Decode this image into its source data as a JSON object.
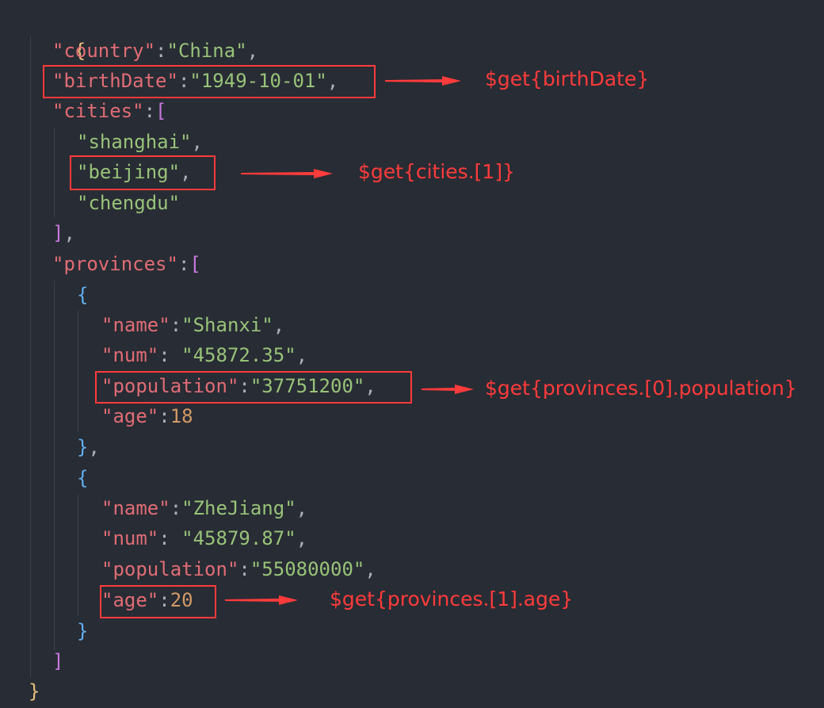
{
  "json": {
    "open_brace": "{",
    "country_key": "\"country\"",
    "country_val": "\"China\"",
    "birthdate_key": "\"birthDate\"",
    "birthdate_val": "\"1949-10-01\"",
    "cities_key": "\"cities\"",
    "cities_items": [
      "\"shanghai\"",
      "\"beijing\"",
      "\"chengdu\""
    ],
    "provinces_key": "\"provinces\"",
    "provinces": [
      {
        "name_key": "\"name\"",
        "name_val": "\"Shanxi\"",
        "num_key": "\"num\"",
        "num_val": "\"45872.35\"",
        "population_key": "\"population\"",
        "population_val": "\"37751200\"",
        "age_key": "\"age\"",
        "age_val": "18"
      },
      {
        "name_key": "\"name\"",
        "name_val": "\"ZheJiang\"",
        "num_key": "\"num\"",
        "num_val": "\"45879.87\"",
        "population_key": "\"population\"",
        "population_val": "\"55080000\"",
        "age_key": "\"age\"",
        "age_val": "20"
      }
    ],
    "close_brace": "}"
  },
  "annotations": [
    "$get{birthDate}",
    "$get{cities.[1]}",
    "$get{provinces.[0].population}",
    "$get{provinces.[1].age}"
  ],
  "colors": {
    "background": "#282c34",
    "key": "#e06c75",
    "string": "#98c379",
    "number": "#d19a66",
    "annotation": "#ff3b3b"
  }
}
